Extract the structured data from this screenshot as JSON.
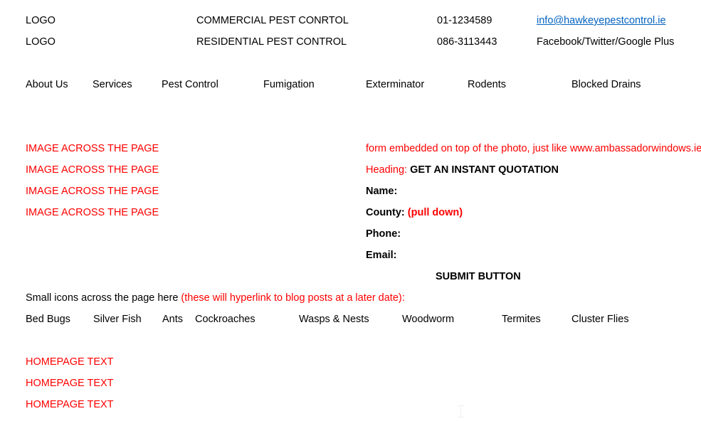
{
  "header": {
    "logo_primary": "LOGO",
    "logo_secondary": "LOGO",
    "segment_commercial": "COMMERCIAL PEST CONRTOL",
    "segment_residential": "RESIDENTIAL PEST CONTROL",
    "phone_landline": "01-1234589",
    "phone_mobile": "086-3113443",
    "email": "info@hawkeyepestcontrol.ie",
    "social": "Facebook/Twitter/Google Plus"
  },
  "nav": {
    "items": [
      {
        "label": "About Us"
      },
      {
        "label": "Services"
      },
      {
        "label": "Pest Control"
      },
      {
        "label": "Fumigation"
      },
      {
        "label": "Exterminator"
      },
      {
        "label": "Rodents"
      },
      {
        "label": "Blocked Drains"
      }
    ]
  },
  "hero": {
    "image_placeholders": [
      "IMAGE  ACROSS THE PAGE",
      "IMAGE  ACROSS THE PAGE",
      "IMAGE  ACROSS THE PAGE",
      "IMAGE  ACROSS THE PAGE"
    ]
  },
  "form": {
    "note": "form embedded on top of the photo, just like www.ambassadorwindows.ie",
    "heading_label": "Heading:",
    "heading_value": "GET AN INSTANT QUOTATION",
    "fields": [
      {
        "label": "Name:",
        "annotation": ""
      },
      {
        "label": "County:",
        "annotation": "(pull down)"
      },
      {
        "label": "Phone:",
        "annotation": ""
      },
      {
        "label": "Email:",
        "annotation": ""
      }
    ],
    "submit_label": "SUBMIT BUTTON"
  },
  "icons_section": {
    "note_black": "Small icons across the page here ",
    "note_red": "(these will hyperlink to blog posts at a later date):",
    "pests": [
      {
        "label": "Bed Bugs"
      },
      {
        "label": "Silver Fish"
      },
      {
        "label": "Ants"
      },
      {
        "label": "Cockroaches"
      },
      {
        "label": "Wasps & Nests"
      },
      {
        "label": "Woodworm"
      },
      {
        "label": "Termites"
      },
      {
        "label": "Cluster Flies"
      }
    ]
  },
  "homepage_text": {
    "lines": [
      "HOMEPAGE TEXT",
      "HOMEPAGE TEXT",
      "HOMEPAGE TEXT"
    ]
  },
  "colors": {
    "annotation_red": "#FF0000",
    "link_blue": "#0563C1",
    "body_black": "#000000",
    "page_background": "#FFFFFF"
  }
}
